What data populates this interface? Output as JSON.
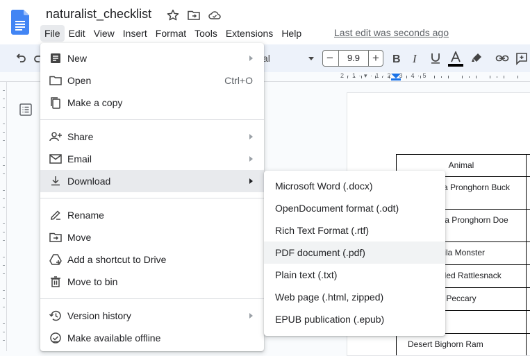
{
  "title_bar": {
    "doc_title": "naturalist_checklist",
    "last_edit": "Last edit was seconds ago"
  },
  "menu_bar": {
    "items": [
      "File",
      "Edit",
      "View",
      "Insert",
      "Format",
      "Tools",
      "Extensions",
      "Help"
    ],
    "active": "File"
  },
  "toolbar": {
    "font_name": "al",
    "font_size": "9.9",
    "size_minus": "−",
    "size_plus": "+"
  },
  "ruler": {
    "numbers": "2 · 1 · ▾ · 1 · 2 · 3 · 4 · 5"
  },
  "file_menu": {
    "new": "New",
    "open": "Open",
    "open_shortcut": "Ctrl+O",
    "make_copy": "Make a copy",
    "share": "Share",
    "email": "Email",
    "download": "Download",
    "rename": "Rename",
    "move": "Move",
    "add_shortcut": "Add a shortcut to Drive",
    "move_to_bin": "Move to bin",
    "version_history": "Version history",
    "make_offline": "Make available offline"
  },
  "download_menu": {
    "items": [
      "Microsoft Word (.docx)",
      "OpenDocument format (.odt)",
      "Rich Text Format (.rtf)",
      "PDF document (.pdf)",
      "Plain text (.txt)",
      "Web page (.html, zipped)",
      "EPUB publication (.epub)"
    ],
    "highlighted": "PDF document (.pdf)"
  },
  "table": {
    "header": "Animal",
    "rows": [
      "California Pronghorn Buck",
      "California Pronghorn Doe",
      "Gila Monster",
      "Speckled Rattlesnack",
      "Peccary",
      "",
      "Desert Bighorn Ram"
    ]
  },
  "colors": {
    "accent_blue": "#1a73e8",
    "menu_hover": "#e8eaed",
    "toolbar_bg": "#edf2fa"
  }
}
